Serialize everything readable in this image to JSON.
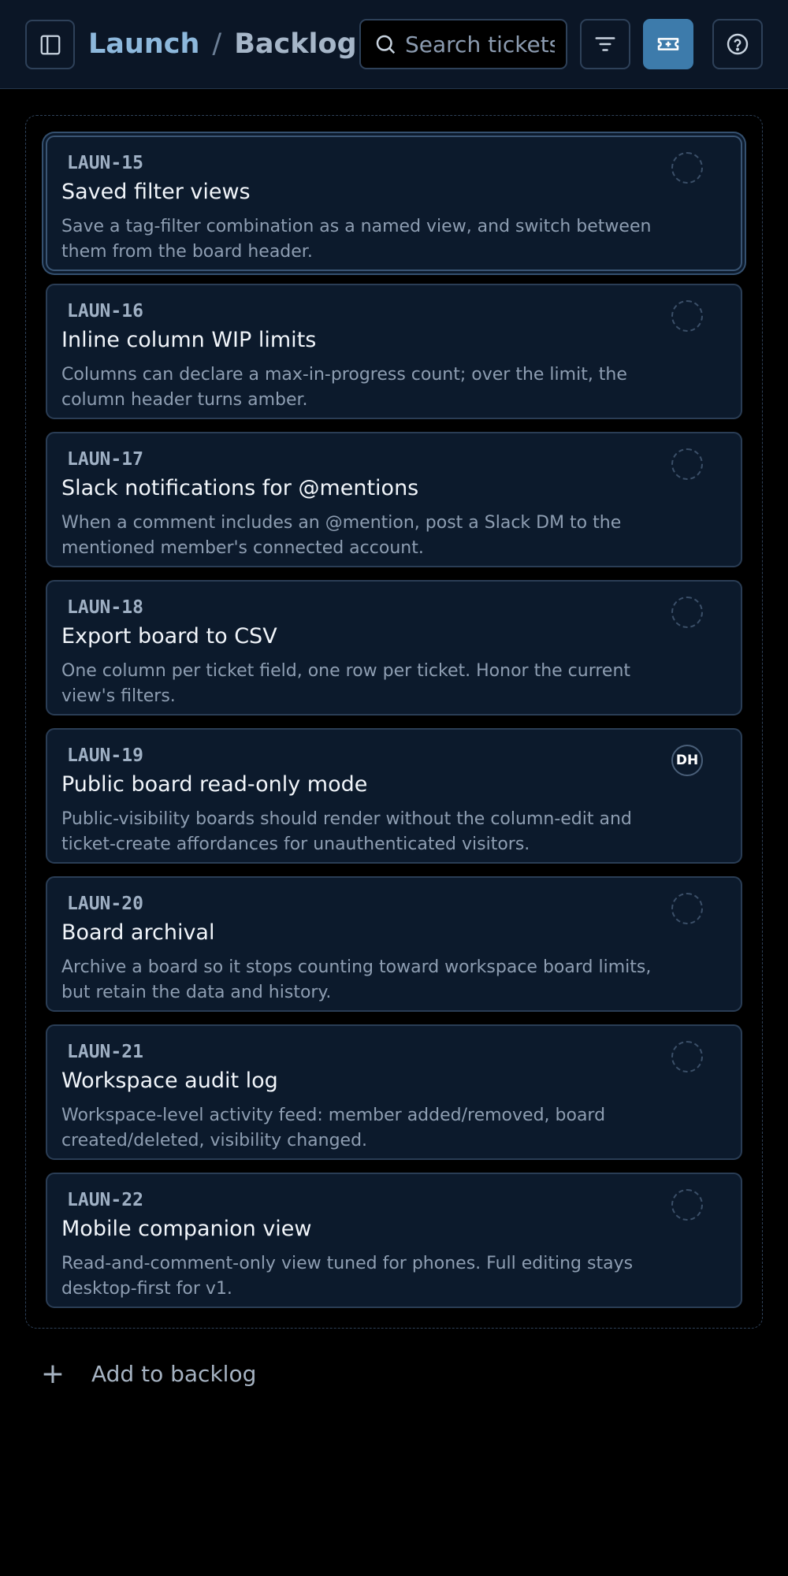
{
  "header": {
    "breadcrumb": {
      "project": "Launch",
      "separator": "/",
      "page": "Backlog"
    },
    "search": {
      "placeholder": "Search tickets",
      "value": ""
    },
    "icons": {
      "sidebar_toggle": "sidebar-toggle-icon",
      "search": "search-icon",
      "filter": "filter-icon",
      "ticket": "ticket-plus-icon",
      "help": "help-circle-icon"
    }
  },
  "colors": {
    "accent": "#3d7bab",
    "project_crumb": "#8db8dc",
    "card_background": "#0c1a2c",
    "page_background": "#000000"
  },
  "backlog": {
    "cards": [
      {
        "key": "LAUN-15",
        "title": "Saved filter views",
        "description": "Save a tag-filter combination as a named view, and switch between them from the board header.",
        "assignee": "",
        "selected": true
      },
      {
        "key": "LAUN-16",
        "title": "Inline column WIP limits",
        "description": "Columns can declare a max-in-progress count; over the limit, the column header turns amber.",
        "assignee": ""
      },
      {
        "key": "LAUN-17",
        "title": "Slack notifications for @mentions",
        "description": "When a comment includes an @mention, post a Slack DM to the mentioned member's connected account.",
        "assignee": ""
      },
      {
        "key": "LAUN-18",
        "title": "Export board to CSV",
        "description": "One column per ticket field, one row per ticket. Honor the current view's filters.",
        "assignee": ""
      },
      {
        "key": "LAUN-19",
        "title": "Public board read-only mode",
        "description": "Public-visibility boards should render without the column-edit and ticket-create affordances for unauthenticated visitors.",
        "assignee": "DH"
      },
      {
        "key": "LAUN-20",
        "title": "Board archival",
        "description": "Archive a board so it stops counting toward workspace board limits, but retain the data and history.",
        "assignee": ""
      },
      {
        "key": "LAUN-21",
        "title": "Workspace audit log",
        "description": "Workspace-level activity feed: member added/removed, board created/deleted, visibility changed.",
        "assignee": ""
      },
      {
        "key": "LAUN-22",
        "title": "Mobile companion view",
        "description": "Read-and-comment-only view tuned for phones. Full editing stays desktop-first for v1.",
        "assignee": ""
      }
    ],
    "add_label": "Add to backlog",
    "add_icon": "plus-icon"
  }
}
